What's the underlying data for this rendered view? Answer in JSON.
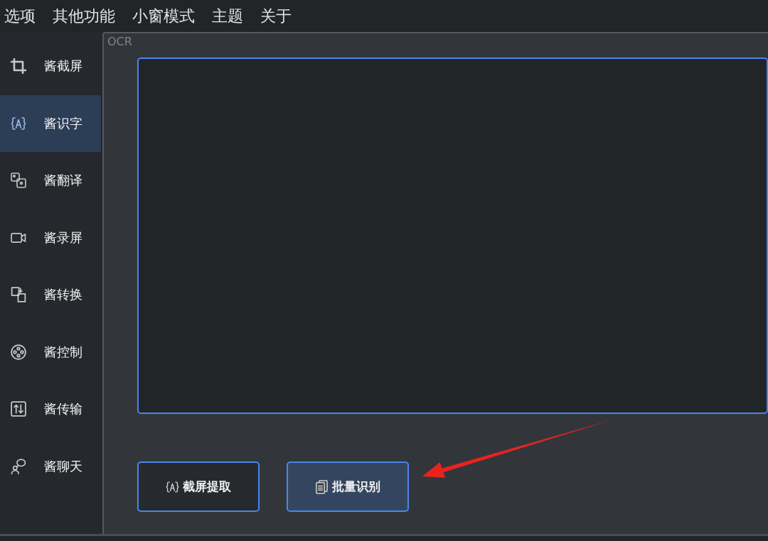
{
  "menu": [
    "选项",
    "其他功能",
    "小窗模式",
    "主题",
    "关于"
  ],
  "sidebar": {
    "items": [
      {
        "label": "酱截屏",
        "kind": "screenshot",
        "selected": false
      },
      {
        "label": "酱识字",
        "kind": "ocr",
        "selected": true
      },
      {
        "label": "酱翻译",
        "kind": "translate",
        "selected": false
      },
      {
        "label": "酱录屏",
        "kind": "record",
        "selected": false
      },
      {
        "label": "酱转换",
        "kind": "convert",
        "selected": false
      },
      {
        "label": "酱控制",
        "kind": "control",
        "selected": false
      },
      {
        "label": "酱传输",
        "kind": "transfer",
        "selected": false
      },
      {
        "label": "酱聊天",
        "kind": "chat",
        "selected": false
      }
    ]
  },
  "panel": {
    "title": "OCR",
    "buttons": [
      {
        "label": "截屏提取",
        "kind": "ocr",
        "highlighted": false
      },
      {
        "label": "批量识别",
        "kind": "batch",
        "highlighted": true
      }
    ]
  },
  "annotations": [
    {
      "kind": "arrow"
    }
  ]
}
